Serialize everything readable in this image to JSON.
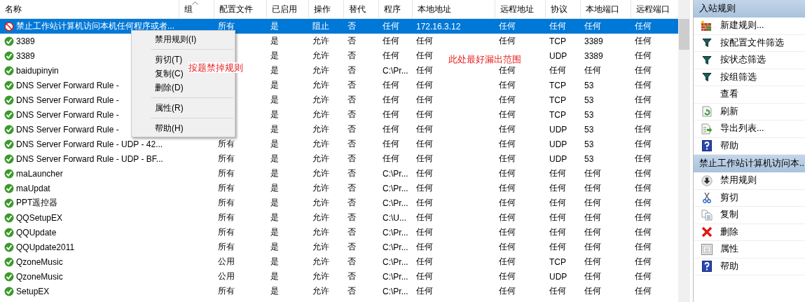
{
  "table": {
    "columns": [
      {
        "label": "名称"
      },
      {
        "label": "组",
        "sorted": true
      },
      {
        "label": "配置文件"
      },
      {
        "label": "已启用"
      },
      {
        "label": "操作"
      },
      {
        "label": "替代"
      },
      {
        "label": "程序"
      },
      {
        "label": "本地地址"
      },
      {
        "label": "远程地址"
      },
      {
        "label": "协议"
      },
      {
        "label": "本地端口"
      },
      {
        "label": "远程端口"
      }
    ],
    "rows": [
      {
        "kind": "block",
        "selected": true,
        "cells": [
          "禁止工作站计算机访问本机任何程序或者...",
          null,
          "所有",
          "是",
          "阻止",
          "否",
          "任何",
          "172.16.3.12",
          "任何",
          "任何",
          "任何",
          "任何"
        ]
      },
      {
        "kind": "allow",
        "selected": false,
        "cells": [
          "3389",
          null,
          null,
          "是",
          "允许",
          "否",
          "任何",
          "任何",
          "任何",
          "TCP",
          "3389",
          "任何"
        ]
      },
      {
        "kind": "allow",
        "selected": false,
        "cells": [
          "3389",
          null,
          null,
          "是",
          "允许",
          "否",
          "任何",
          "任何",
          null,
          "UDP",
          "3389",
          "任何"
        ]
      },
      {
        "kind": "allow",
        "selected": false,
        "cells": [
          "baidupinyin",
          null,
          null,
          "是",
          "允许",
          "否",
          "C:\\Pr...",
          "任何",
          "任何",
          "任何",
          "任何",
          "任何"
        ]
      },
      {
        "kind": "allow",
        "selected": false,
        "cells": [
          "DNS Server Forward Rule -",
          null,
          null,
          "是",
          "允许",
          "否",
          "任何",
          "任何",
          "任何",
          "TCP",
          "53",
          "任何"
        ]
      },
      {
        "kind": "allow",
        "selected": false,
        "cells": [
          "DNS Server Forward Rule -",
          null,
          null,
          "是",
          "允许",
          "否",
          "任何",
          "任何",
          "任何",
          "TCP",
          "53",
          "任何"
        ]
      },
      {
        "kind": "allow",
        "selected": false,
        "cells": [
          "DNS Server Forward Rule -",
          null,
          null,
          "是",
          "允许",
          "否",
          "任何",
          "任何",
          "任何",
          "TCP",
          "53",
          "任何"
        ]
      },
      {
        "kind": "allow",
        "selected": false,
        "cells": [
          "DNS Server Forward Rule -",
          null,
          null,
          "是",
          "允许",
          "否",
          "任何",
          "任何",
          "任何",
          "UDP",
          "53",
          "任何"
        ]
      },
      {
        "kind": "allow",
        "selected": false,
        "cells": [
          "DNS Server Forward Rule - UDP - 42...",
          null,
          "所有",
          "是",
          "允许",
          "否",
          "任何",
          "任何",
          "任何",
          "UDP",
          "53",
          "任何"
        ]
      },
      {
        "kind": "allow",
        "selected": false,
        "cells": [
          "DNS Server Forward Rule - UDP - BF...",
          null,
          "所有",
          "是",
          "允许",
          "否",
          "任何",
          "任何",
          "任何",
          "UDP",
          "53",
          "任何"
        ]
      },
      {
        "kind": "allow",
        "selected": false,
        "cells": [
          "maLauncher",
          null,
          "所有",
          "是",
          "允许",
          "否",
          "C:\\Pr...",
          "任何",
          "任何",
          "任何",
          "任何",
          "任何"
        ]
      },
      {
        "kind": "allow",
        "selected": false,
        "cells": [
          "maUpdat",
          null,
          "所有",
          "是",
          "允许",
          "否",
          "C:\\Pr...",
          "任何",
          "任何",
          "任何",
          "任何",
          "任何"
        ]
      },
      {
        "kind": "allow",
        "selected": false,
        "cells": [
          "PPT遥控器",
          null,
          "所有",
          "是",
          "允许",
          "否",
          "C:\\Pr...",
          "任何",
          "任何",
          "任何",
          "任何",
          "任何"
        ]
      },
      {
        "kind": "allow",
        "selected": false,
        "cells": [
          "QQSetupEX",
          null,
          "所有",
          "是",
          "允许",
          "否",
          "C:\\U...",
          "任何",
          "任何",
          "任何",
          "任何",
          "任何"
        ]
      },
      {
        "kind": "allow",
        "selected": false,
        "cells": [
          "QQUpdate",
          null,
          "所有",
          "是",
          "允许",
          "否",
          "C:\\Pr...",
          "任何",
          "任何",
          "任何",
          "任何",
          "任何"
        ]
      },
      {
        "kind": "allow",
        "selected": false,
        "cells": [
          "QQUpdate2011",
          null,
          "所有",
          "是",
          "允许",
          "否",
          "C:\\Pr...",
          "任何",
          "任何",
          "任何",
          "任何",
          "任何"
        ]
      },
      {
        "kind": "allow",
        "selected": false,
        "cells": [
          "QzoneMusic",
          null,
          "公用",
          "是",
          "允许",
          "否",
          "C:\\Pr...",
          "任何",
          "任何",
          "TCP",
          "任何",
          "任何"
        ]
      },
      {
        "kind": "allow",
        "selected": false,
        "cells": [
          "QzoneMusic",
          null,
          "公用",
          "是",
          "允许",
          "否",
          "C:\\Pr...",
          "任何",
          "任何",
          "UDP",
          "任何",
          "任何"
        ]
      },
      {
        "kind": "allow",
        "selected": false,
        "cells": [
          "SetupEX",
          null,
          "所有",
          "是",
          "允许",
          "否",
          "C:\\Pr...",
          "任何",
          "任何",
          "任何",
          "任何",
          "任何"
        ]
      }
    ]
  },
  "context_menu": {
    "groups": [
      [
        "禁用规则(I)"
      ],
      [
        "剪切(T)",
        "复制(C)",
        "删除(D)"
      ],
      [
        "属性(R)"
      ],
      [
        "帮助(H)"
      ]
    ]
  },
  "annotations": [
    "按题禁掉规则",
    "此处最好漏出范围"
  ],
  "actions_panel": {
    "sections": [
      {
        "title": "入站规则",
        "items": [
          {
            "kind": "new-rule",
            "label": "新建规则..."
          },
          {
            "kind": "filter",
            "label": "按配置文件筛选"
          },
          {
            "kind": "filter",
            "label": "按状态筛选"
          },
          {
            "kind": "filter",
            "label": "按组筛选"
          },
          {
            "kind": "none",
            "label": "查看"
          },
          {
            "kind": "refresh",
            "label": "刷新"
          },
          {
            "kind": "export",
            "label": "导出列表..."
          },
          {
            "kind": "help",
            "label": "帮助"
          }
        ]
      },
      {
        "title": "禁止工作站计算机访问本...",
        "items": [
          {
            "kind": "disable",
            "label": "禁用规则"
          },
          {
            "kind": "cut",
            "label": "剪切"
          },
          {
            "kind": "copy",
            "label": "复制"
          },
          {
            "kind": "delete",
            "label": "删除"
          },
          {
            "kind": "properties",
            "label": "属性"
          },
          {
            "kind": "help",
            "label": "帮助"
          }
        ]
      }
    ]
  }
}
